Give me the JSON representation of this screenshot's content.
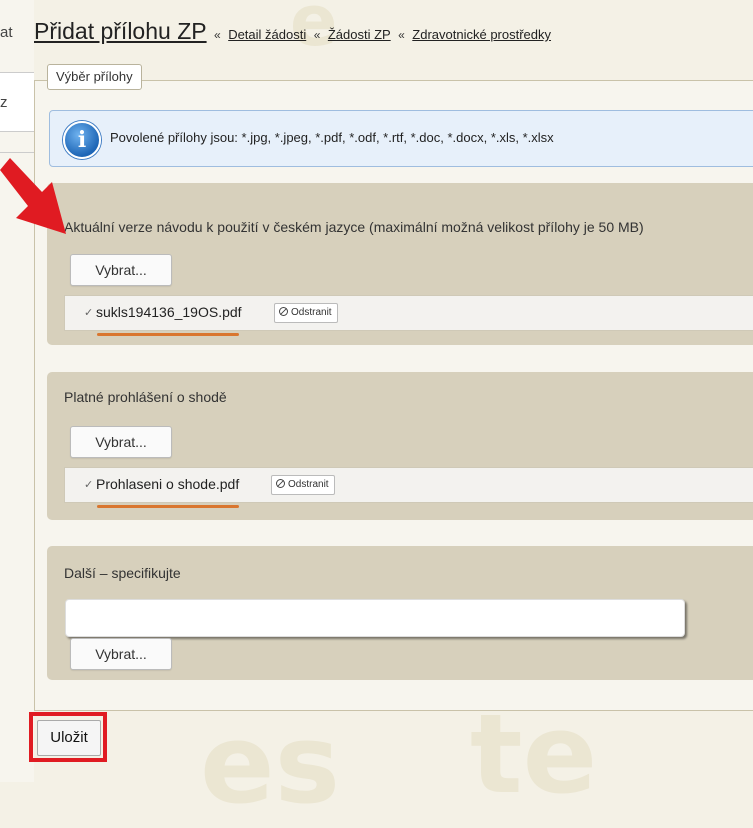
{
  "left_fragments": {
    "line1": "at",
    "line2": "z"
  },
  "header": {
    "title": "Přidat přílohu ZP",
    "separator": "«",
    "breadcrumbs": [
      "Detail žádosti",
      "Žádosti ZP",
      "Zdravotnické prostředky"
    ]
  },
  "form": {
    "legend": "Výběr přílohy",
    "info": {
      "icon": "info-icon",
      "text": "Povolené přílohy jsou: *.jpg, *.jpeg, *.pdf, *.odf, *.rtf, *.doc, *.docx, *.xls, *.xlsx"
    },
    "sections": [
      {
        "label": "Aktuální verze návodu k použití v českém jazyce (maximální možná velikost přílohy je 50 MB)",
        "button": "Vybrat...",
        "file": {
          "check": "✓",
          "name": "sukls194136_19OS.pdf",
          "remove_label": "Odstranit"
        }
      },
      {
        "label": "Platné prohlášení o shodě",
        "button": "Vybrat...",
        "file": {
          "check": "✓",
          "name": "Prohlaseni o shode.pdf",
          "remove_label": "Odstranit"
        }
      },
      {
        "label": "Další – specifikujte",
        "input_value": "",
        "button": "Vybrat..."
      }
    ],
    "save_label": "Uložit"
  },
  "colors": {
    "annotation_red": "#e01b22",
    "underline_orange": "#d9762f",
    "section_bg": "#d7d0bc",
    "info_bg": "#e7f0fa"
  }
}
